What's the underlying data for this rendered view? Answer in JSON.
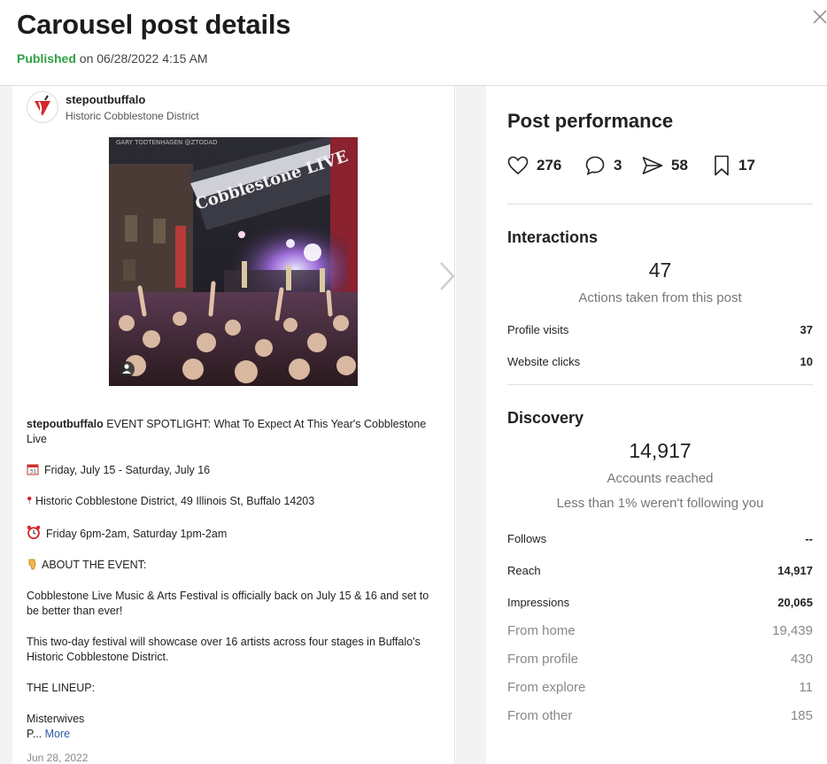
{
  "header": {
    "title": "Carousel post details",
    "status": "Published",
    "published_suffix": "on 06/28/2022 4:15 AM"
  },
  "post": {
    "username": "stepoutbuffalo",
    "location": "Historic Cobblestone District",
    "photo_text": {
      "credit": "GARY TODTENHAGEN @ZTODAD",
      "stage_sign": "Cobblestone LIVE"
    },
    "caption": {
      "username": "stepoutbuffalo",
      "intro": "EVENT SPOTLIGHT: What To Expect At This Year's Cobblestone Live",
      "date_line": "Friday, July 15 - Saturday, July 16",
      "location_line": "Historic Cobblestone District, 49 Illinois St, Buffalo 14203",
      "time_line": "Friday 6pm-2am, Saturday 1pm-2am",
      "about_heading": "ABOUT THE EVENT:",
      "para1": "Cobblestone Live Music & Arts Festival is officially back on July 15 & 16 and set to be better than ever!",
      "para2": "This two-day festival will showcase over 16 artists across four stages in Buffalo's Historic Cobblestone District.",
      "lineup_heading": "THE LINEUP:",
      "artist1": "Misterwives",
      "truncated": "P...",
      "more_label": "More"
    },
    "date": "Jun 28, 2022"
  },
  "performance": {
    "title": "Post performance",
    "stats": {
      "likes": "276",
      "comments": "3",
      "shares": "58",
      "saves": "17"
    },
    "interactions": {
      "title": "Interactions",
      "total": "47",
      "subtitle": "Actions taken from this post",
      "rows": [
        {
          "label": "Profile visits",
          "value": "37"
        },
        {
          "label": "Website clicks",
          "value": "10"
        }
      ]
    },
    "discovery": {
      "title": "Discovery",
      "total": "14,917",
      "subtitle": "Accounts reached",
      "note": "Less than 1% weren't following you",
      "rows": [
        {
          "label": "Follows",
          "value": "--"
        },
        {
          "label": "Reach",
          "value": "14,917"
        },
        {
          "label": "Impressions",
          "value": "20,065"
        }
      ],
      "sub_rows": [
        {
          "label": "From home",
          "value": "19,439"
        },
        {
          "label": "From profile",
          "value": "430"
        },
        {
          "label": "From explore",
          "value": "11"
        },
        {
          "label": "From other",
          "value": "185"
        }
      ]
    }
  },
  "colors": {
    "published_green": "#2ea043",
    "link_blue": "#2f5ca8",
    "muted_gray": "#888888",
    "brand_red": "#d6262c"
  },
  "icons": {
    "close": "close-icon",
    "carousel_next": "chevron-right-icon",
    "likes": "heart-icon",
    "comments": "comment-icon",
    "shares": "paper-plane-icon",
    "saves": "bookmark-icon",
    "calendar": "calendar-icon",
    "pin": "pin-icon",
    "alarm": "alarm-clock-icon",
    "pointing": "pointing-down-icon",
    "multi_user": "user-tag-icon"
  }
}
